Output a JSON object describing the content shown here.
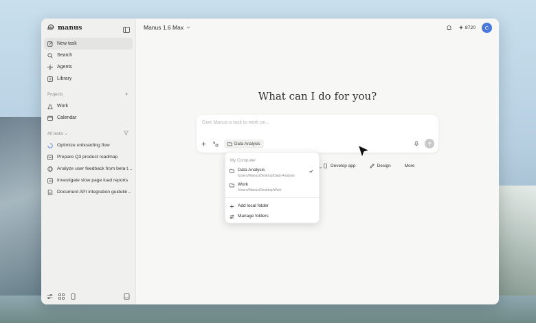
{
  "sidebar": {
    "brand": "manus",
    "nav": [
      {
        "label": "New task",
        "icon": "edit-icon"
      },
      {
        "label": "Search",
        "icon": "search-icon"
      },
      {
        "label": "Agents",
        "icon": "agents-icon"
      },
      {
        "label": "Library",
        "icon": "library-icon"
      }
    ],
    "projects_heading": "Projects",
    "projects": [
      {
        "label": "Work",
        "icon": "flask-icon"
      },
      {
        "label": "Calendar",
        "icon": "calendar-icon"
      }
    ],
    "tasks_heading": "All tasks",
    "tasks": [
      {
        "label": "Optimize onboarding flow",
        "icon": "loading-icon"
      },
      {
        "label": "Prepare Q3 product roadmap",
        "icon": "mail-icon"
      },
      {
        "label": "Analyze user feedback from beta test",
        "icon": "globe-icon"
      },
      {
        "label": "Investigate slow page load reports",
        "icon": "chart-icon"
      },
      {
        "label": "Document API integration guidelin...",
        "icon": "document-icon"
      }
    ]
  },
  "topbar": {
    "model": "Manus 1.6 Max",
    "credits": "8720",
    "avatar_initial": "C"
  },
  "main": {
    "heading": "What can I do for you?",
    "composer_placeholder": "Give Manus a task to work on...",
    "selected_folder": "Data Analysis",
    "quick_actions": [
      "Develop app",
      "Design",
      "More"
    ]
  },
  "folder_menu": {
    "heading": "My Computer",
    "folders": [
      {
        "name": "Data Analysis",
        "path": "/Users/Manus/Desktop/Data-Analysis",
        "selected": true
      },
      {
        "name": "Work",
        "path": "/Users/Manus/Desktop/Work",
        "selected": false
      }
    ],
    "actions": [
      "Add local folder",
      "Manage folders"
    ]
  },
  "colors": {
    "accent": "#4a78d8",
    "sidebar_bg": "#f0f0ee",
    "main_bg": "#f7f7f6"
  }
}
